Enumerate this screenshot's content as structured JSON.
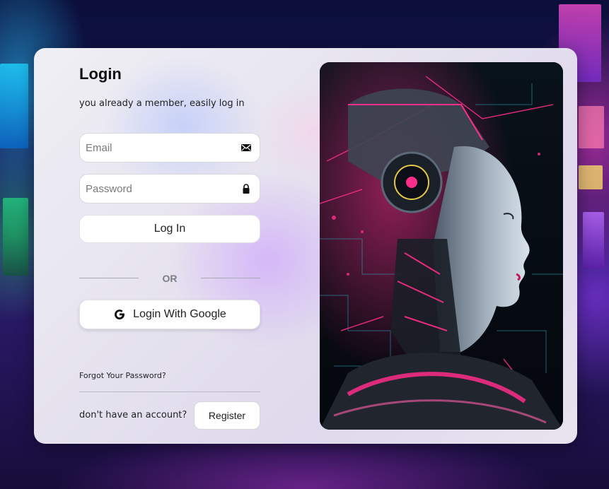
{
  "login": {
    "title": "Login",
    "subtitle": "you already a member, easily log in",
    "email_placeholder": "Email",
    "password_placeholder": "Password",
    "login_button": "Log In",
    "divider_text": "OR",
    "google_button": "Login With Google",
    "forgot_password": "Forgot Your Password?",
    "no_account": "don't have an account?",
    "register_button": "Register"
  },
  "icons": {
    "email": "envelope-icon",
    "password": "lock-icon",
    "google": "google-g-icon"
  },
  "colors": {
    "card": "#ecebf2",
    "button": "#ffffff",
    "text": "#111111",
    "divider_text": "#7c7c86",
    "accent_pink": "#ff2d8a",
    "accent_cyan": "#3fd0ff"
  }
}
